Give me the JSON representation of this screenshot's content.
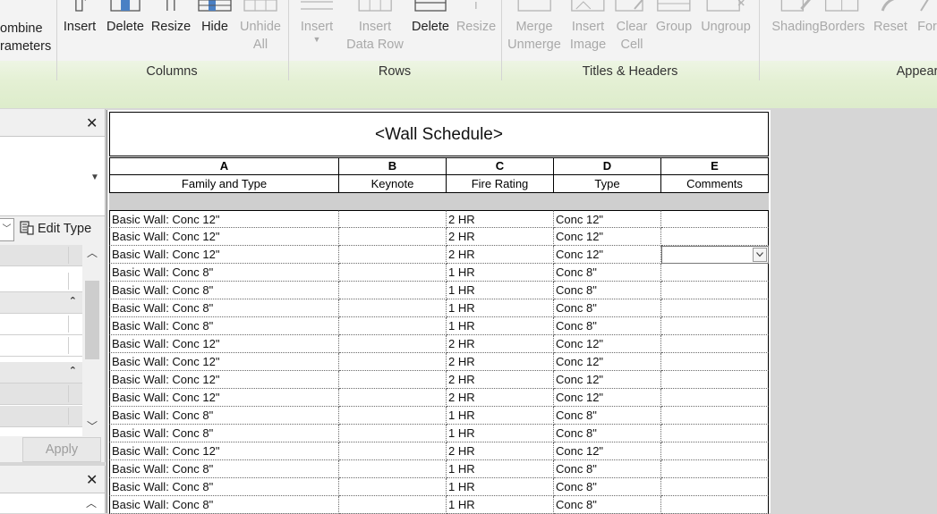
{
  "ribbon": {
    "left_partial": {
      "line1": "ombine",
      "line2": "rameters"
    },
    "groups": {
      "columns": {
        "label": "Columns",
        "buttons": [
          {
            "label": "Insert",
            "disabled": false,
            "icon": "insert-column-icon"
          },
          {
            "label": "Delete",
            "disabled": false,
            "icon": "delete-column-icon"
          },
          {
            "label": "Resize",
            "disabled": false,
            "icon": "resize-column-icon"
          },
          {
            "label": "Hide",
            "disabled": false,
            "icon": "hide-column-icon"
          },
          {
            "label": "Unhide",
            "label2": "All",
            "disabled": true,
            "icon": "unhide-all-icon"
          }
        ]
      },
      "rows": {
        "label": "Rows",
        "buttons": [
          {
            "label": "Insert",
            "disabled": true,
            "icon": "insert-row-icon"
          },
          {
            "label": "Insert",
            "label2": "Data Row",
            "disabled": true,
            "icon": "insert-data-row-icon"
          },
          {
            "label": "Delete",
            "disabled": false,
            "icon": "delete-row-icon"
          },
          {
            "label": "Resize",
            "disabled": true,
            "icon": "resize-row-icon"
          }
        ]
      },
      "titles": {
        "label": "Titles & Headers",
        "buttons": [
          {
            "label": "Merge",
            "label2": "Unmerge",
            "disabled": true,
            "icon": "merge-icon"
          },
          {
            "label": "Insert",
            "label2": "Image",
            "disabled": true,
            "icon": "insert-image-icon"
          },
          {
            "label": "Clear",
            "label2": "Cell",
            "disabled": true,
            "icon": "clear-cell-icon"
          },
          {
            "label": "Group",
            "disabled": true,
            "icon": "group-icon"
          },
          {
            "label": "Ungroup",
            "disabled": true,
            "icon": "ungroup-icon"
          }
        ]
      },
      "appearance": {
        "label": "Appear",
        "buttons": [
          {
            "label": "Shading",
            "disabled": true,
            "icon": "shading-icon"
          },
          {
            "label": "Borders",
            "disabled": true,
            "icon": "borders-icon"
          },
          {
            "label": "Reset",
            "disabled": true,
            "icon": "reset-icon"
          },
          {
            "label": "For",
            "disabled": true,
            "icon": "font-icon"
          }
        ]
      }
    }
  },
  "properties": {
    "close_glyph": "✕",
    "edit_type_label": "Edit Type",
    "apply_label": "Apply",
    "rows": [
      {
        "kind": "shaded"
      },
      {
        "kind": "plain"
      },
      {
        "kind": "category",
        "collapsed": true
      },
      {
        "kind": "plain"
      },
      {
        "kind": "plain"
      },
      {
        "kind": "category",
        "collapsed": true
      },
      {
        "kind": "shaded"
      },
      {
        "kind": "shaded"
      }
    ]
  },
  "schedule": {
    "title": "<Wall Schedule>",
    "columns": [
      {
        "letter": "A",
        "name": "Family and Type"
      },
      {
        "letter": "B",
        "name": "Keynote"
      },
      {
        "letter": "C",
        "name": "Fire Rating"
      },
      {
        "letter": "D",
        "name": "Type"
      },
      {
        "letter": "E",
        "name": "Comments"
      }
    ],
    "rows": [
      [
        "Basic Wall: Conc 12\"",
        "",
        "2 HR",
        "Conc 12\"",
        ""
      ],
      [
        "Basic Wall: Conc 12\"",
        "",
        "2 HR",
        "Conc 12\"",
        ""
      ],
      [
        "Basic Wall: Conc 12\"",
        "",
        "2 HR",
        "Conc 12\"",
        ""
      ],
      [
        "Basic Wall: Conc 8\"",
        "",
        "1 HR",
        "Conc 8\"",
        ""
      ],
      [
        "Basic Wall: Conc 8\"",
        "",
        "1 HR",
        "Conc 8\"",
        ""
      ],
      [
        "Basic Wall: Conc 8\"",
        "",
        "1 HR",
        "Conc 8\"",
        ""
      ],
      [
        "Basic Wall: Conc 8\"",
        "",
        "1 HR",
        "Conc 8\"",
        ""
      ],
      [
        "Basic Wall: Conc 12\"",
        "",
        "2 HR",
        "Conc 12\"",
        ""
      ],
      [
        "Basic Wall: Conc 12\"",
        "",
        "2 HR",
        "Conc 12\"",
        ""
      ],
      [
        "Basic Wall: Conc 12\"",
        "",
        "2 HR",
        "Conc 12\"",
        ""
      ],
      [
        "Basic Wall: Conc 12\"",
        "",
        "2 HR",
        "Conc 12\"",
        ""
      ],
      [
        "Basic Wall: Conc 8\"",
        "",
        "1 HR",
        "Conc 8\"",
        ""
      ],
      [
        "Basic Wall: Conc 8\"",
        "",
        "1 HR",
        "Conc 8\"",
        ""
      ],
      [
        "Basic Wall: Conc 12\"",
        "",
        "2 HR",
        "Conc 12\"",
        ""
      ],
      [
        "Basic Wall: Conc 8\"",
        "",
        "1 HR",
        "Conc 8\"",
        ""
      ],
      [
        "Basic Wall: Conc 8\"",
        "",
        "1 HR",
        "Conc 8\"",
        ""
      ],
      [
        "Basic Wall: Conc 8\"",
        "",
        "1 HR",
        "Conc 8\"",
        ""
      ]
    ],
    "active_cell": {
      "row": 2,
      "col": 4
    }
  }
}
